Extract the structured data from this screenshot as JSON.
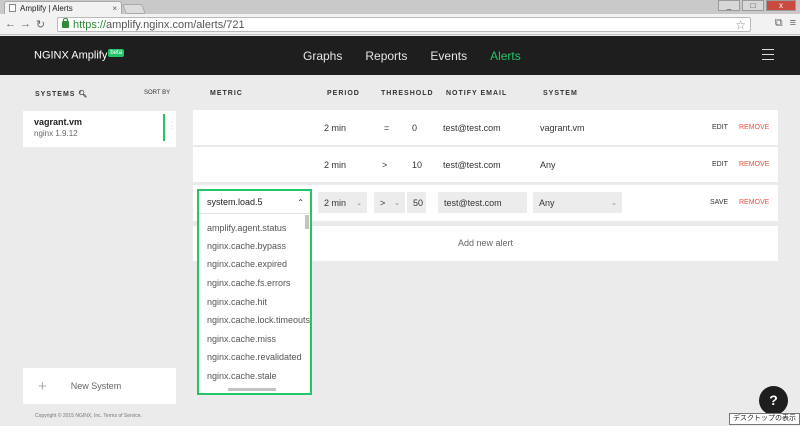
{
  "browser": {
    "tab_title": "Amplify | Alerts",
    "tab_close": "×",
    "url_scheme": "https://",
    "url_rest": "amplify.nginx.com/alerts/721",
    "win_min": "_",
    "win_max": "□",
    "win_close": "x"
  },
  "app": {
    "logo": "NGINX Amplify",
    "beta": "beta",
    "nav": [
      "Graphs",
      "Reports",
      "Events",
      "Alerts"
    ],
    "active_nav": "Alerts"
  },
  "sidebar": {
    "systems_label": "SYSTEMS",
    "sort_label": "SORT BY",
    "system": {
      "name": "vagrant.vm",
      "version": "nginx 1.9.12"
    },
    "new_system": "New System",
    "copyright": "Copyright © 2015 NGINX, Inc. Terms of Service."
  },
  "table": {
    "headers": {
      "metric": "METRIC",
      "period": "PERIOD",
      "threshold": "THRESHOLD",
      "notify": "NOTIFY EMAIL",
      "system": "SYSTEM"
    },
    "rows": [
      {
        "metric": "",
        "period": "2 min",
        "op": "=",
        "value": "0",
        "email": "test@test.com",
        "system": "vagrant.vm",
        "edit": "EDIT",
        "remove": "REMOVE"
      },
      {
        "metric": "",
        "period": "2 min",
        "op": ">",
        "value": "10",
        "email": "test@test.com",
        "system": "Any",
        "edit": "EDIT",
        "remove": "REMOVE"
      }
    ],
    "edit_row": {
      "metric": "system.load.5",
      "period": "2 min",
      "op": ">",
      "value": "50",
      "email": "test@test.com",
      "system": "Any",
      "save": "SAVE",
      "remove": "REMOVE"
    },
    "add_alert": "Add new alert"
  },
  "dropdown": {
    "options": [
      "amplify.agent.status",
      "nginx.cache.bypass",
      "nginx.cache.expired",
      "nginx.cache.fs.errors",
      "nginx.cache.hit",
      "nginx.cache.lock.timeouts",
      "nginx.cache.miss",
      "nginx.cache.revalidated",
      "nginx.cache.stale"
    ]
  },
  "help": {
    "label": "?"
  },
  "tooltip": "デスクトップの表示",
  "colors": {
    "accent": "#22c56a",
    "remove": "#e8553e",
    "header": "#1e1e1e"
  }
}
